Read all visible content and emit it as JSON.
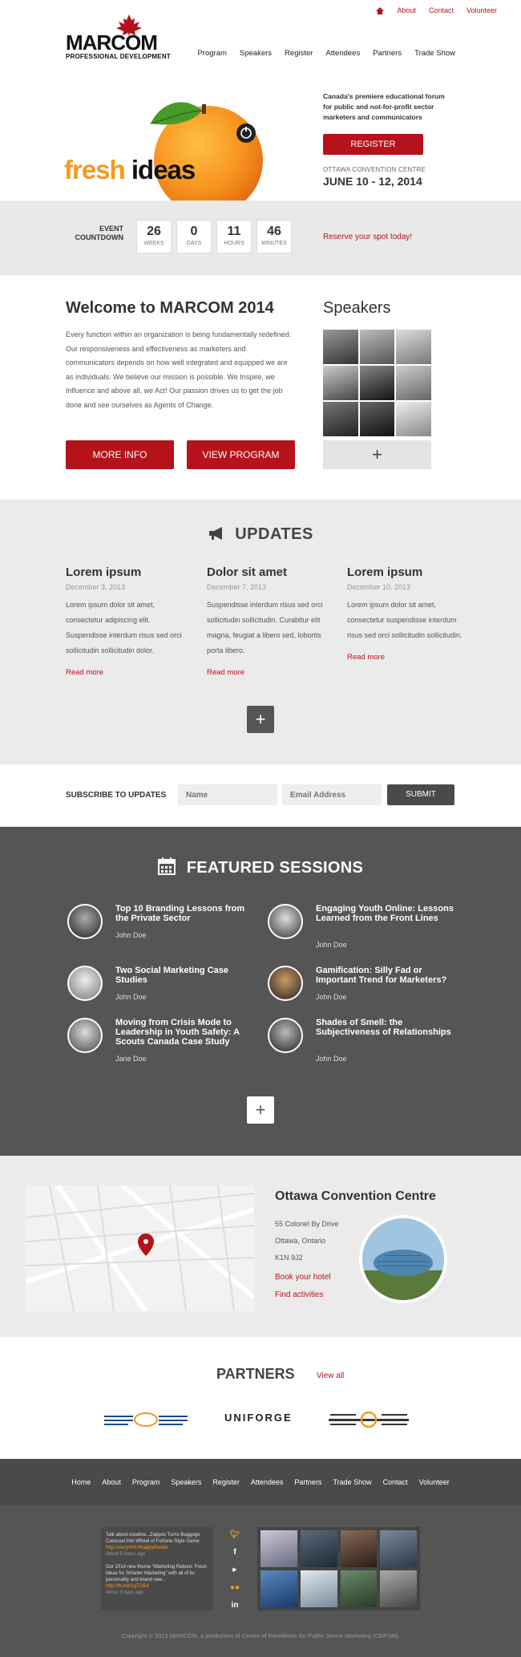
{
  "util_nav": {
    "home_icon": "home-icon",
    "about": "About",
    "contact": "Contact",
    "volunteer": "Volunteer"
  },
  "logo": {
    "name": "MARCOM",
    "sub": "PROFESSIONAL DEVELOPMENT"
  },
  "main_nav": [
    "Program",
    "Speakers",
    "Register",
    "Attendees",
    "Partners",
    "Trade Show"
  ],
  "hero": {
    "fresh": "fresh",
    "ideas": "ideas",
    "tagline": "Canada's premiere educational forum for public and not-for-profit sector marketers and communicators",
    "register": "REGISTER",
    "venue": "OTTAWA CONVENTION CENTRE",
    "dates": "JUNE 10 - 12, 2014"
  },
  "countdown": {
    "title_line1": "EVENT",
    "title_line2": "COUNTDOWN",
    "boxes": [
      {
        "num": "26",
        "unit": "WEEKS"
      },
      {
        "num": "0",
        "unit": "DAYS"
      },
      {
        "num": "11",
        "unit": "HOURS"
      },
      {
        "num": "46",
        "unit": "MINUTES"
      }
    ],
    "reserve": "Reserve your spot today!"
  },
  "welcome": {
    "title": "Welcome to MARCOM 2014",
    "body": "Every function within an organization is being fundamentally redefined. Our responsiveness and effectiveness as marketers and communicators depends on how well integrated and equipped we are as individuals. We believe our mission is possible. We Inspire, we Influence and above all, we Act! Our passion drives us to get the job done and see ourselves as Agents of Change.",
    "more_info": "MORE INFO",
    "view_program": "VIEW PROGRAM",
    "speakers_title": "Speakers",
    "speakers_plus": "+"
  },
  "updates": {
    "title": "UPDATES",
    "items": [
      {
        "title": "Lorem ipsum",
        "date": "December 3, 2013",
        "body": "Lorem ipsum dolor sit amet, consectetur adipiscing elit. Suspendisse interdum risus sed orci sollicitudin sollicitudin dolor.",
        "more": "Read more"
      },
      {
        "title": "Dolor sit amet",
        "date": "December 7, 2013",
        "body": "Suspendisse interdum risus sed orci sollicitudin sollicitudin. Curabitur elit magna, feugiat a libero sed, lobortis porta libero.",
        "more": "Read more"
      },
      {
        "title": "Lorem ipsum",
        "date": "December 10, 2013",
        "body": "Lorem ipsum dolor sit amet, consectetur suspendisse interdum risus sed orci sollicitudin sollicitudin.",
        "more": "Read more"
      }
    ],
    "plus": "+"
  },
  "subscribe": {
    "label": "SUBSCRIBE TO UPDATES",
    "name_ph": "Name",
    "email_ph": "Email Address",
    "submit": "SUBMIT"
  },
  "featured": {
    "title": "FEATURED SESSIONS",
    "sessions": [
      {
        "title": "Top 10 Branding Lessons from the Private Sector",
        "speaker": "John Doe"
      },
      {
        "title": "Engaging Youth Online: Lessons Learned from the Front Lines",
        "speaker": "John Doe"
      },
      {
        "title": "Two Social Marketing Case Studies",
        "speaker": "John Doe"
      },
      {
        "title": "Gamification: Silly Fad or Important Trend for Marketers?",
        "speaker": "John Doe"
      },
      {
        "title": "Moving from Crisis Mode to Leadership in Youth Safety: A Scouts Canada Case Study",
        "speaker": "Jane Doe"
      },
      {
        "title": "Shades of Smell: the Subjectiveness of Relationships",
        "speaker": "John Doe"
      }
    ],
    "plus": "+"
  },
  "venue": {
    "title": "Ottawa Convention Centre",
    "addr1": "55 Colonel By Drive",
    "addr2": "Ottawa, Ontario",
    "addr3": "K1N 9J2",
    "book": "Book your hotel",
    "find": "Find activities"
  },
  "partners": {
    "title": "PARTNERS",
    "view_all": "View all",
    "uniforge": "UNIFORGE"
  },
  "footer_nav": [
    "Home",
    "About",
    "Program",
    "Speakers",
    "Register",
    "Attendees",
    "Partners",
    "Trade Show",
    "Contact",
    "Volunteer"
  ],
  "tweets": {
    "t1": "Talk about creative...Zappos Turns Baggage Carousel Into Wheel of Fortune-Style Game",
    "t1_link": "http://ow.ly/rHt #happyfriends",
    "t1_when": "About 5 hours ago",
    "t2": "Our 2014 new theme \"Marketing Reboot: Fresh Ideas for Smarter Marketing\" with all of its personality and brand new...",
    "t2_link": "http://fb.me/1yTC6sl",
    "t2_when": "About 3 days ago"
  },
  "social_icons": [
    "twitter-icon",
    "facebook-icon",
    "youtube-icon",
    "flickr-icon",
    "linkedin-icon"
  ],
  "copyright": "Copyright © 2013 MARCOM, a production of Centre of Excellence for Public Sector Marketing (CEPSM)."
}
